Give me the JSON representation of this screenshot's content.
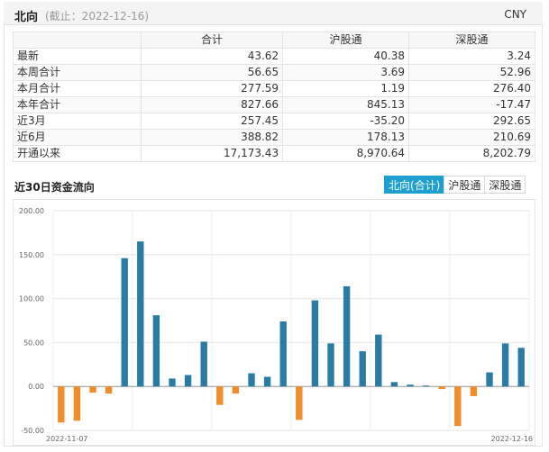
{
  "header": {
    "title": "北向",
    "subtitle": "(截止：2022-12-16)",
    "currency": "CNY"
  },
  "table": {
    "columns": [
      "",
      "合计",
      "沪股通",
      "深股通"
    ],
    "rows": [
      {
        "label": "最新",
        "values": [
          "43.62",
          "40.38",
          "3.24"
        ]
      },
      {
        "label": "本周合计",
        "values": [
          "56.65",
          "3.69",
          "52.96"
        ]
      },
      {
        "label": "本月合计",
        "values": [
          "277.59",
          "1.19",
          "276.40"
        ]
      },
      {
        "label": "本年合计",
        "values": [
          "827.66",
          "845.13",
          "-17.47"
        ]
      },
      {
        "label": "近3月",
        "values": [
          "257.45",
          "-35.20",
          "292.65"
        ]
      },
      {
        "label": "近6月",
        "values": [
          "388.82",
          "178.13",
          "210.69"
        ]
      },
      {
        "label": "开通以来",
        "values": [
          "17,173.43",
          "8,970.64",
          "8,202.79"
        ]
      }
    ]
  },
  "flow": {
    "title": "近30日资金流向",
    "tabs": [
      "北向(合计)",
      "沪股通",
      "深股通"
    ],
    "active_tab": 0
  },
  "colors": {
    "positive": "#2b7ca4",
    "negative": "#f08c2a",
    "tab_active": "#1e9fd0"
  },
  "chart_data": {
    "type": "bar",
    "title": "",
    "xlabel": "",
    "ylabel": "",
    "ylim": [
      -50,
      200
    ],
    "yticks": [
      "200.00",
      "150.00",
      "100.00",
      "50.00",
      "0.00",
      "-50.00"
    ],
    "x_first_label": "2022-11-07",
    "x_last_label": "2022-12-16",
    "grid": true,
    "values": [
      -41,
      -39,
      -7,
      -8,
      146,
      165,
      81,
      9,
      13,
      51,
      -21,
      -8,
      15,
      11,
      74,
      -38,
      98,
      49,
      114,
      40,
      59,
      5,
      2,
      1,
      -3,
      -45,
      -11,
      16,
      49,
      44
    ]
  }
}
